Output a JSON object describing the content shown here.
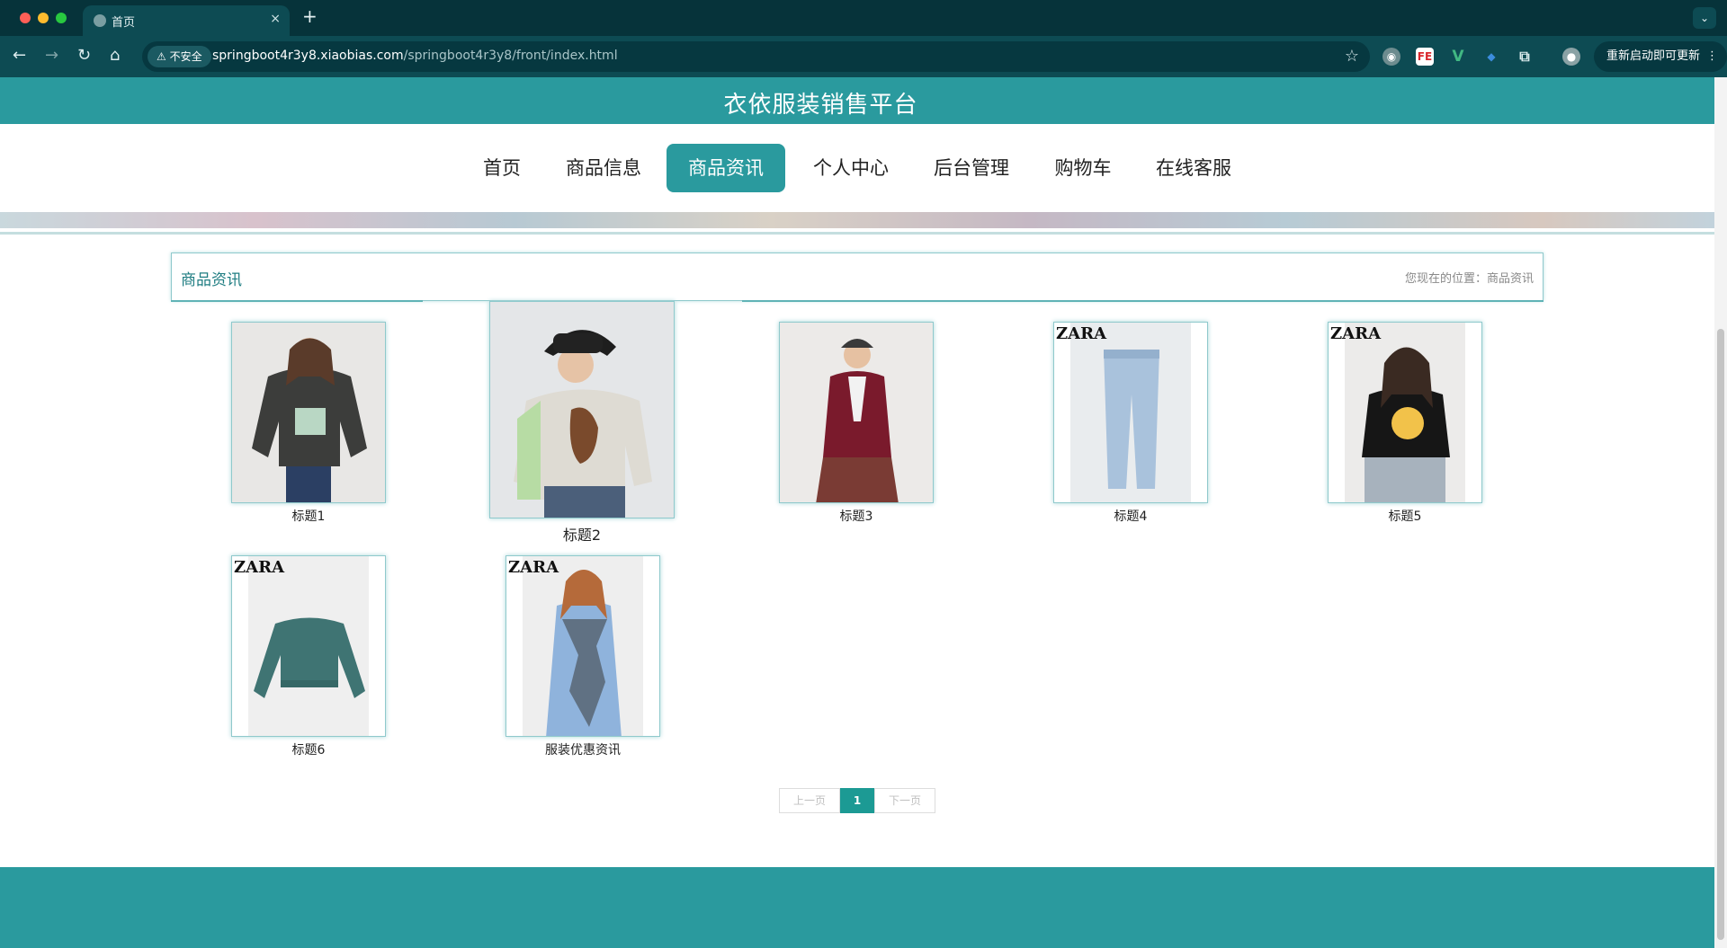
{
  "browser": {
    "tab_title": "首页",
    "tab_close": "×",
    "new_tab": "+",
    "tab_menu": "⌄",
    "insecure_label": "不安全",
    "url_host": "springboot4r3y8.xiaobias.com",
    "url_path": "/springboot4r3y8/front/index.html",
    "update_label": "重新启动即可更新",
    "update_dots": "⋮",
    "extensions": [
      "FE",
      "V"
    ]
  },
  "site": {
    "title": "衣依服装销售平台"
  },
  "nav": {
    "items": [
      "首页",
      "商品信息",
      "商品资讯",
      "个人中心",
      "后台管理",
      "购物车",
      "在线客服"
    ],
    "active": "商品资讯"
  },
  "section": {
    "title": "商品资讯",
    "breadcrumb": "您现在的位置：商品资讯"
  },
  "articles": [
    {
      "title": "标题1",
      "image": "woman-grey-graphic-sweatshirt"
    },
    {
      "title": "标题2",
      "image": "woman-bucket-hat-sweater"
    },
    {
      "title": "标题3",
      "image": "woman-burgundy-cardigan-plaid-skirt"
    },
    {
      "title": "标题4",
      "image": "zara-light-blue-jeans"
    },
    {
      "title": "标题5",
      "image": "zara-black-tshirt-printed"
    },
    {
      "title": "标题6",
      "image": "zara-green-cropped-sweatshirt"
    },
    {
      "title": "服装优惠资讯",
      "image": "zara-woman-floral-dress"
    }
  ],
  "brand_mark": "ZARA",
  "pagination": {
    "prev": "上一页",
    "current": "1",
    "next": "下一页"
  },
  "colors": {
    "primary": "#2a9a9e",
    "chrome": "#0d4b53",
    "pager_active": "#1c9a94"
  }
}
